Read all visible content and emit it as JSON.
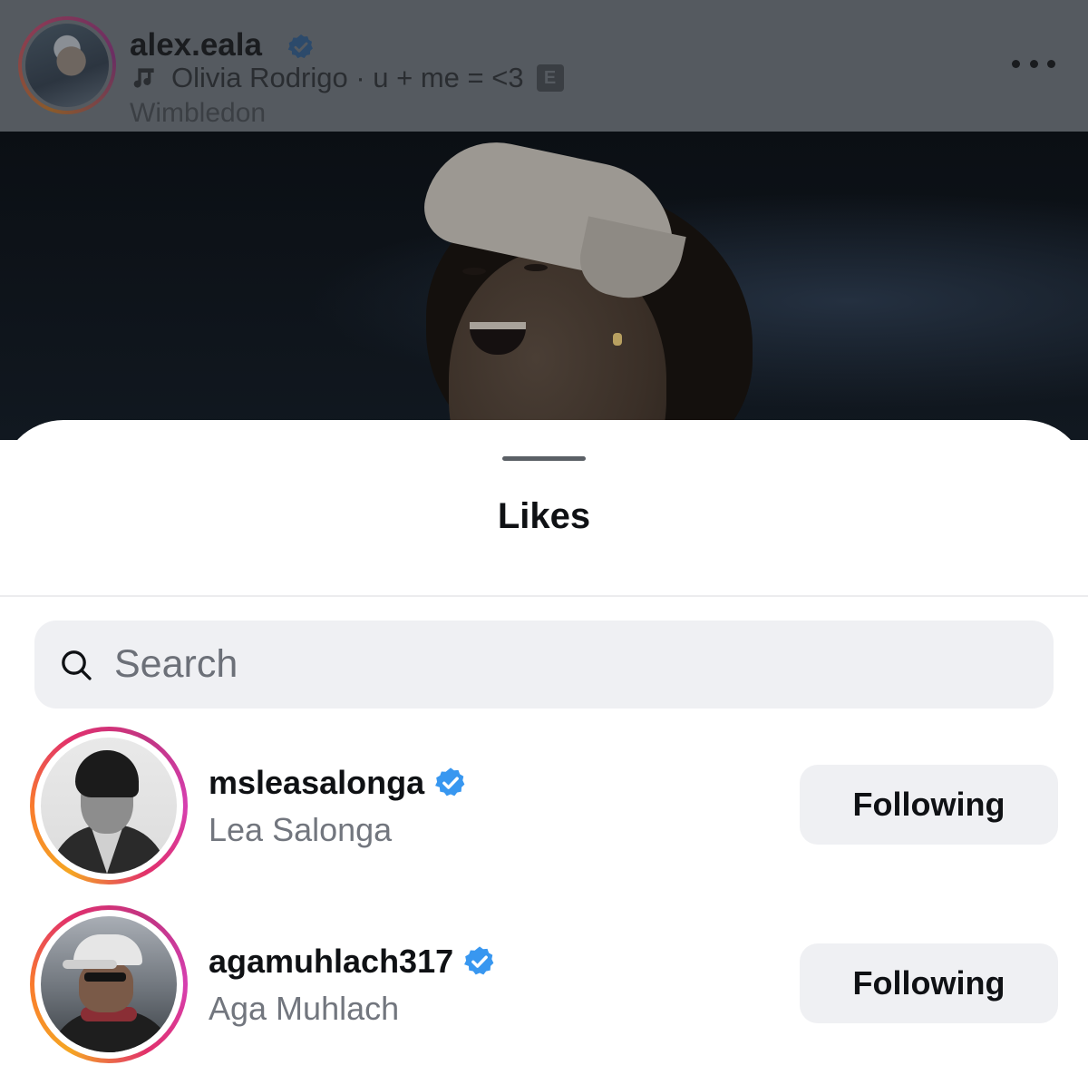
{
  "post": {
    "username": "alex.eala",
    "music_artist": "Olivia Rodrigo",
    "music_separator": " · ",
    "music_track": "u + me = <3",
    "explicit_badge": "E",
    "location": "Wimbledon",
    "icons": {
      "verified": "verified-badge-icon",
      "music": "music-note-icon",
      "more": "more-options-icon"
    }
  },
  "likes_sheet": {
    "title": "Likes",
    "search": {
      "placeholder": "Search",
      "value": "",
      "icon": "search-icon"
    },
    "users": [
      {
        "handle": "msleasalonga",
        "full_name": "Lea Salonga",
        "verified": true,
        "button_label": "Following"
      },
      {
        "handle": "agamuhlach317",
        "full_name": "Aga Muhlach",
        "verified": true,
        "button_label": "Following"
      }
    ]
  },
  "colors": {
    "verified_blue": "#3897f0",
    "story_ring_start": "#f5a623",
    "story_ring_end": "#c13584",
    "button_bg": "#eff0f3",
    "overlay_header": "#555a60"
  }
}
